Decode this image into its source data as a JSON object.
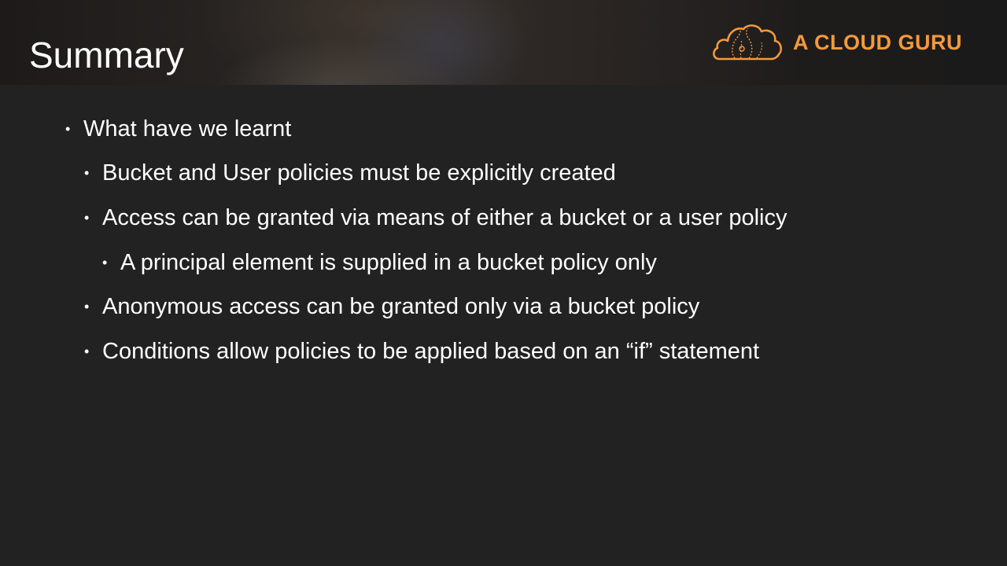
{
  "slide": {
    "title": "Summary",
    "logo": {
      "text": "A CLOUD GURU",
      "icon": "cloud-logo-icon",
      "color": "#f39a3c"
    },
    "bullets": [
      {
        "level": 1,
        "text": "What have we learnt"
      },
      {
        "level": 2,
        "text": "Bucket and User policies must be explicitly created"
      },
      {
        "level": 2,
        "text": "Access can be granted via means of either a bucket or a user policy"
      },
      {
        "level": 3,
        "text": "A principal element is supplied in a bucket policy only"
      },
      {
        "level": 2,
        "text": "Anonymous access can be granted only via a bucket policy"
      },
      {
        "level": 2,
        "text": "Conditions allow policies to be applied based on an “if” statement"
      }
    ],
    "bullet_glyph": "•"
  },
  "colors": {
    "background": "#222222",
    "text": "#ffffff",
    "accent": "#f39a3c"
  }
}
